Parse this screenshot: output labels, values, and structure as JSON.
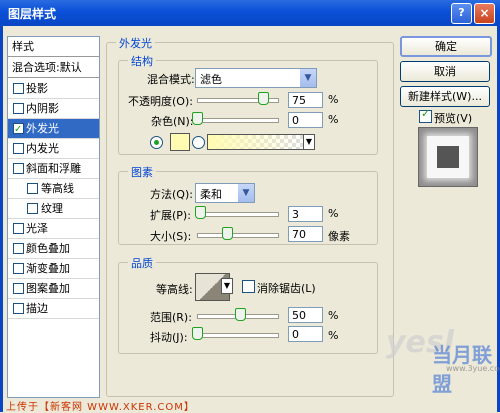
{
  "window": {
    "title": "图层样式",
    "help": "?",
    "close": "×"
  },
  "sidebar": {
    "header": "样式",
    "blend_options": "混合选项:默认",
    "items": [
      {
        "label": "投影",
        "checked": false
      },
      {
        "label": "内阴影",
        "checked": false
      },
      {
        "label": "外发光",
        "checked": true,
        "selected": true
      },
      {
        "label": "内发光",
        "checked": false
      },
      {
        "label": "斜面和浮雕",
        "checked": false
      },
      {
        "label": "等高线",
        "checked": false,
        "sub": true
      },
      {
        "label": "纹理",
        "checked": false,
        "sub": true
      },
      {
        "label": "光泽",
        "checked": false
      },
      {
        "label": "颜色叠加",
        "checked": false
      },
      {
        "label": "渐变叠加",
        "checked": false
      },
      {
        "label": "图案叠加",
        "checked": false
      },
      {
        "label": "描边",
        "checked": false
      }
    ]
  },
  "panel": {
    "title": "外发光",
    "structure": {
      "title": "结构",
      "blend_mode_label": "混合模式:",
      "blend_mode_value": "滤色",
      "opacity_label": "不透明度(O):",
      "opacity_value": "75",
      "opacity_unit": "%",
      "opacity_level": 0.75,
      "noise_label": "杂色(N):",
      "noise_value": "0",
      "noise_unit": "%",
      "color_swatch": "#fffbb2"
    },
    "elements": {
      "title": "图素",
      "method_label": "方法(Q):",
      "method_value": "柔和",
      "spread_label": "扩展(P):",
      "spread_value": "3",
      "spread_unit": "%",
      "size_label": "大小(S):",
      "size_value": "70",
      "size_unit": "像素"
    },
    "quality": {
      "title": "品质",
      "contour_label": "等高线:",
      "antialias_label": "消除锯齿(L)",
      "range_label": "范围(R):",
      "range_value": "50",
      "range_unit": "%",
      "jitter_label": "抖动(J):",
      "jitter_value": "0",
      "jitter_unit": "%"
    }
  },
  "buttons": {
    "ok": "确定",
    "cancel": "取消",
    "new_style": "新建样式(W)...",
    "preview_label": "预览(V)"
  },
  "footer": {
    "text": "上传于【新客网 WWW.XKER.COM】"
  },
  "watermark": {
    "a": "yesl",
    "b": "当月联盟",
    "c": "www.3yue.com"
  }
}
